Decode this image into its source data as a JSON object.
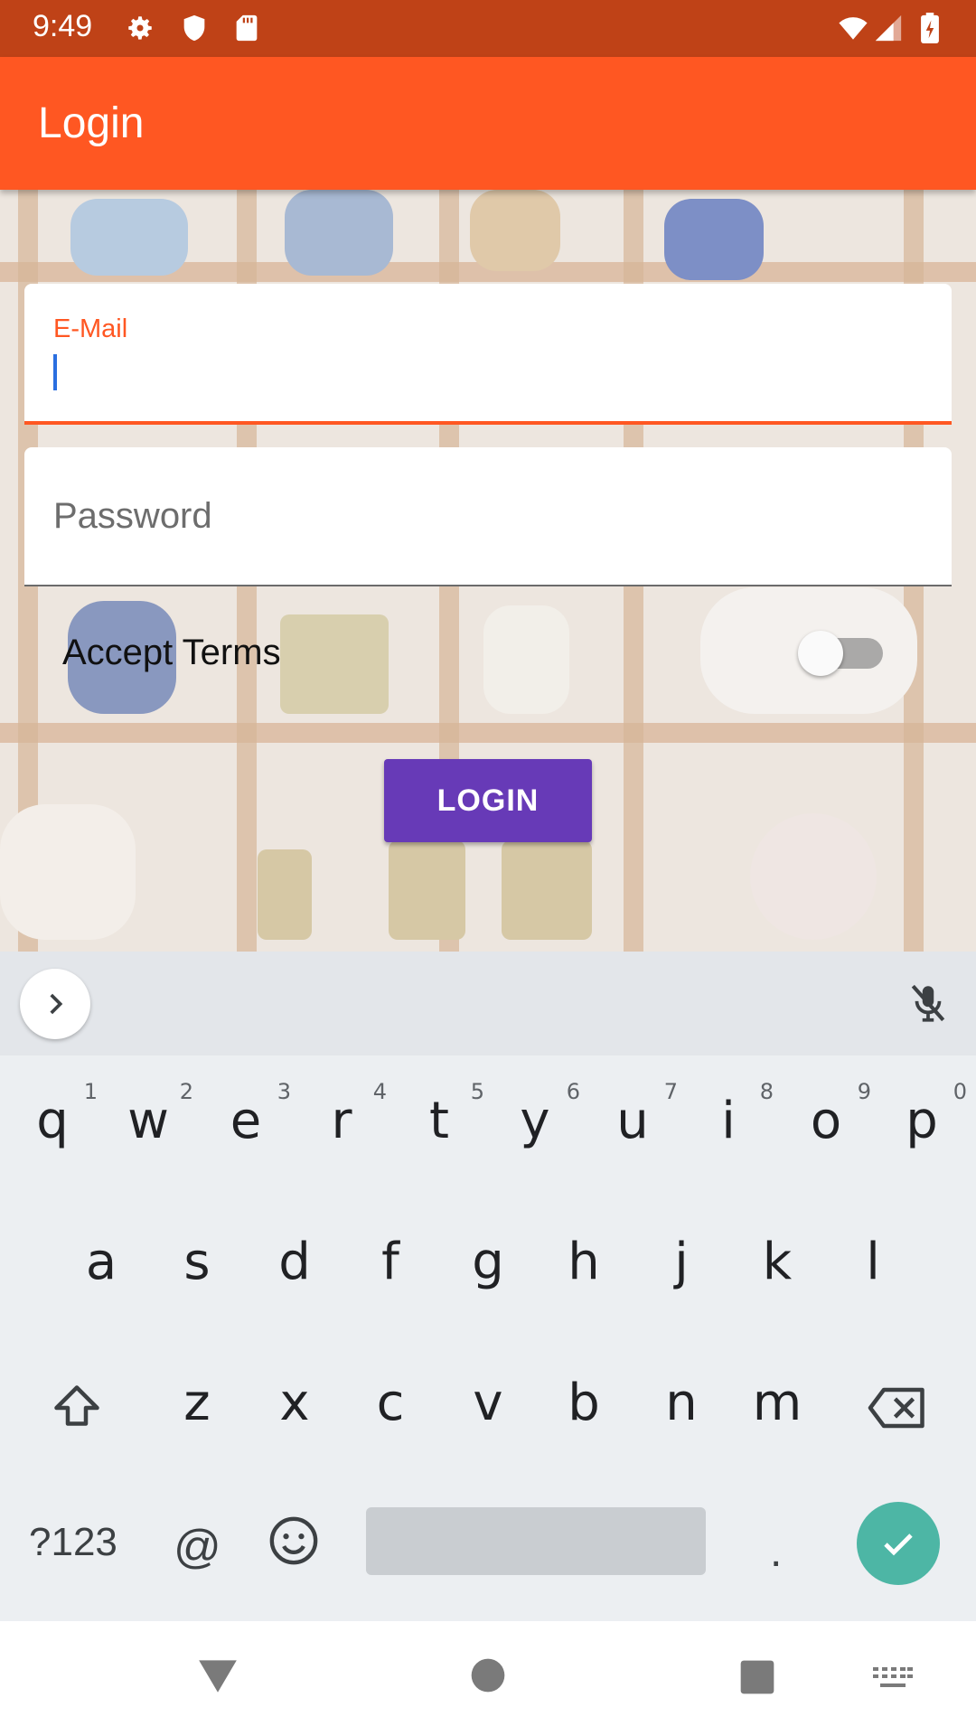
{
  "status_bar": {
    "time": "9:49",
    "icons": [
      "gear-icon",
      "shield-icon",
      "sd-card-icon",
      "wifi-icon",
      "signal-icon",
      "battery-icon"
    ]
  },
  "app_bar": {
    "title": "Login",
    "color": "#ff5722"
  },
  "form": {
    "email": {
      "label": "E-Mail",
      "value": ""
    },
    "password": {
      "placeholder": "Password",
      "value": ""
    },
    "accept_terms": {
      "label": "Accept Terms",
      "checked": false
    },
    "login_button": {
      "label": "LOGIN",
      "color": "#673ab7"
    }
  },
  "keyboard": {
    "row1": [
      {
        "key": "q",
        "hint": "1"
      },
      {
        "key": "w",
        "hint": "2"
      },
      {
        "key": "e",
        "hint": "3"
      },
      {
        "key": "r",
        "hint": "4"
      },
      {
        "key": "t",
        "hint": "5"
      },
      {
        "key": "y",
        "hint": "6"
      },
      {
        "key": "u",
        "hint": "7"
      },
      {
        "key": "i",
        "hint": "8"
      },
      {
        "key": "o",
        "hint": "9"
      },
      {
        "key": "p",
        "hint": "0"
      }
    ],
    "row2": [
      "a",
      "s",
      "d",
      "f",
      "g",
      "h",
      "j",
      "k",
      "l"
    ],
    "row3": [
      "z",
      "x",
      "c",
      "v",
      "b",
      "n",
      "m"
    ],
    "symbols_key": "?123",
    "at_key": "@",
    "period_key": ".",
    "enter_color": "#4db6a5"
  },
  "nav_bar": {
    "icons": [
      "back-icon",
      "home-icon",
      "recents-icon",
      "keyboard-switch-icon"
    ]
  }
}
